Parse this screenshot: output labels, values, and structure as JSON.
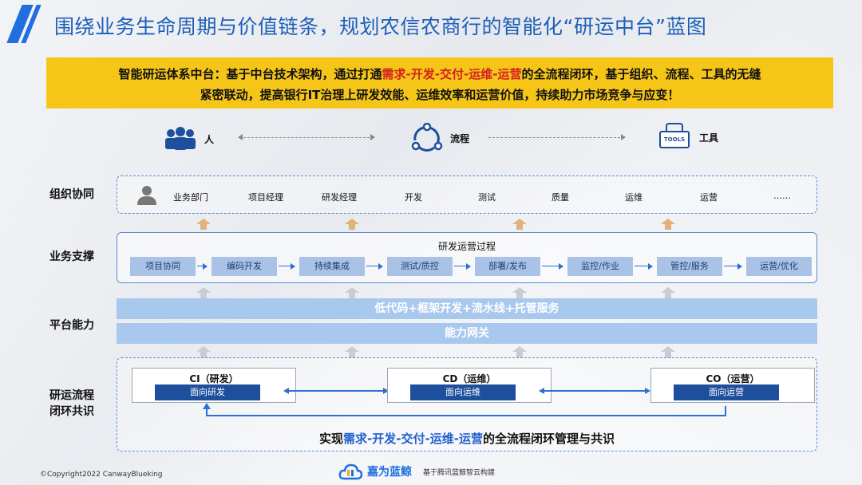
{
  "title": "围绕业务生命周期与价值链条，规划农信农商行的智能化“研运中台”蓝图",
  "banner": {
    "prefix": "智能研运体系中台：基于中台技术架构，通过打通",
    "highlight": "需求-开发-交付-运维-运营",
    "suffix": "的全流程闭环，基于组织、流程、工具的无缝",
    "line2": "紧密联动，提高银行IT治理上研发效能、运维效率和运营价值，持续助力市场竞争与应变！"
  },
  "top_row": {
    "people": "人",
    "process": "流程",
    "tools": "工具",
    "tools_badge": "TOOLS"
  },
  "rows": {
    "org": "组织协同",
    "biz": "业务支撑",
    "platform": "平台能力",
    "loop_line1": "研运流程",
    "loop_line2": "闭环共识"
  },
  "org_items": [
    "业务部门",
    "项目经理",
    "研发经理",
    "开发",
    "测试",
    "质量",
    "运维",
    "运营",
    "……"
  ],
  "biz": {
    "title": "研发运营过程",
    "steps": [
      "项目协同",
      "编码开发",
      "持续集成",
      "测试/质控",
      "部署/发布",
      "监控/作业",
      "管控/服务",
      "运营/优化"
    ]
  },
  "platform": {
    "bar1": "低代码+框架开发+流水线+托管服务",
    "bar2": "能力网关"
  },
  "loop": {
    "cards": [
      {
        "head": "CI（研发）",
        "body": "面向研发"
      },
      {
        "head": "CD（运维）",
        "body": "面向运维"
      },
      {
        "head": "CO（运营）",
        "body": "面向运营"
      }
    ],
    "text_prefix": "实现",
    "text_highlight": "需求-开发-交付-运维-运营",
    "text_suffix": "的全流程闭环管理与共识"
  },
  "footer": {
    "copyright": "©Copyright2022 CanwayBlueking",
    "logo_name": "嘉为蓝鲸",
    "logo_sub": "基于腾讯蓝鲸智云构建"
  },
  "colors": {
    "accent": "#1f6fe0",
    "banner_bg": "#f5c518",
    "highlight_red": "#d42020",
    "step_bg": "#a9c2e6",
    "platform_bg": "#a9c8ee",
    "card_button": "#1e4f9c"
  }
}
